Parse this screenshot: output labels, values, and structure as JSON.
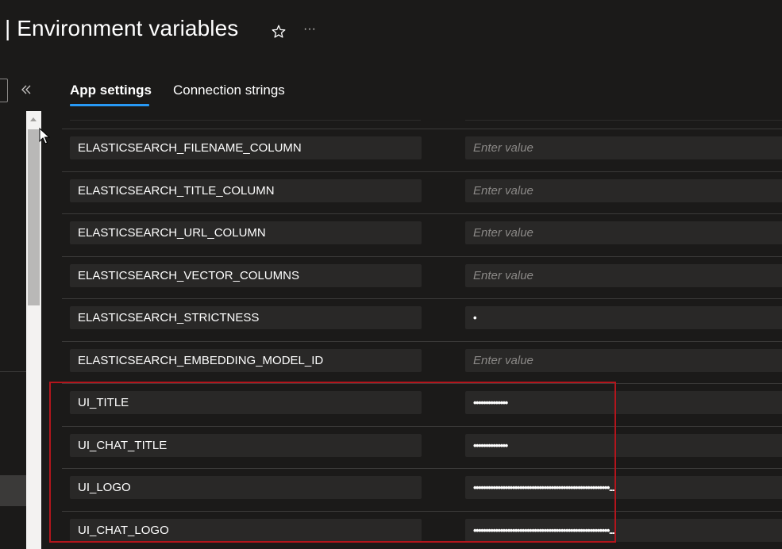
{
  "header": {
    "title": "| Environment variables",
    "favorite_icon": "star-icon",
    "more_icon": "more-icon",
    "more_label": "···"
  },
  "tabs": [
    {
      "label": "App settings",
      "selected": true
    },
    {
      "label": "Connection strings",
      "selected": false
    }
  ],
  "colors": {
    "accent": "#2899f5",
    "highlight": "#b4151c",
    "background": "#1b1a19",
    "input_background": "#292827",
    "placeholder": "#8a8886"
  },
  "settings": {
    "placeholder": "Enter value",
    "rows": [
      {
        "name": "ELASTICSEARCH_FILENAME_COLUMN",
        "value": ""
      },
      {
        "name": "ELASTICSEARCH_TITLE_COLUMN",
        "value": ""
      },
      {
        "name": "ELASTICSEARCH_URL_COLUMN",
        "value": ""
      },
      {
        "name": "ELASTICSEARCH_VECTOR_COLUMNS",
        "value": ""
      },
      {
        "name": "ELASTICSEARCH_STRICTNESS",
        "value": "•"
      },
      {
        "name": "ELASTICSEARCH_EMBEDDING_MODEL_ID",
        "value": ""
      },
      {
        "name": "UI_TITLE",
        "value": "••••••••••••••"
      },
      {
        "name": "UI_CHAT_TITLE",
        "value": "••••••••••••••"
      },
      {
        "name": "UI_LOGO",
        "value": "••••••••••••••••••••••••••••••••••••••••••••••••••••••••..."
      },
      {
        "name": "UI_CHAT_LOGO",
        "value": "••••••••••••••••••••••••••••••••••••••••••••••••••••••••..."
      }
    ]
  }
}
